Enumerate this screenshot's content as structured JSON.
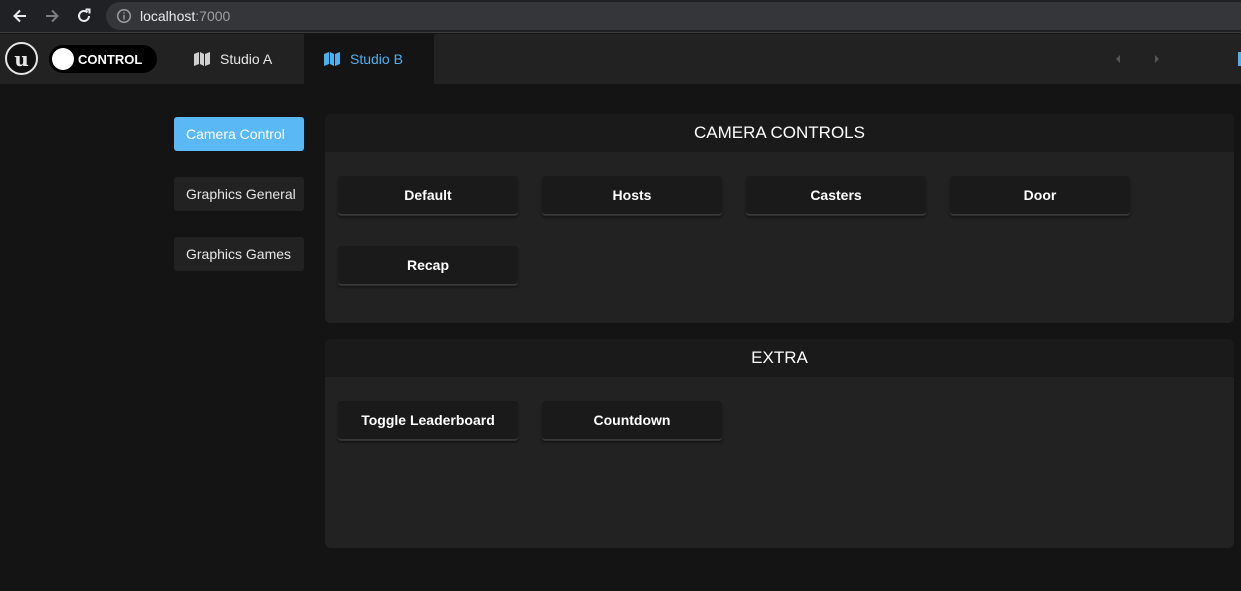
{
  "browser": {
    "url_host": "localhost",
    "url_port": ":7000"
  },
  "header": {
    "toggle_label": "CONTROL",
    "tabs": [
      {
        "label": "Studio A",
        "active": false
      },
      {
        "label": "Studio B",
        "active": true
      }
    ]
  },
  "sidebar": {
    "items": [
      {
        "label": "Camera Control",
        "active": true
      },
      {
        "label": "Graphics General",
        "active": false
      },
      {
        "label": "Graphics Games",
        "active": false
      }
    ]
  },
  "panels": {
    "camera": {
      "title": "CAMERA CONTROLS",
      "buttons": [
        "Default",
        "Hosts",
        "Casters",
        "Door",
        "Recap"
      ]
    },
    "extra": {
      "title": "EXTRA",
      "buttons": [
        "Toggle Leaderboard",
        "Countdown"
      ]
    }
  },
  "colors": {
    "accent": "#5ab8f5",
    "tab_active_text": "#4db0f0",
    "background": "#141414",
    "panel": "#222222",
    "button": "#1a1a1a"
  }
}
